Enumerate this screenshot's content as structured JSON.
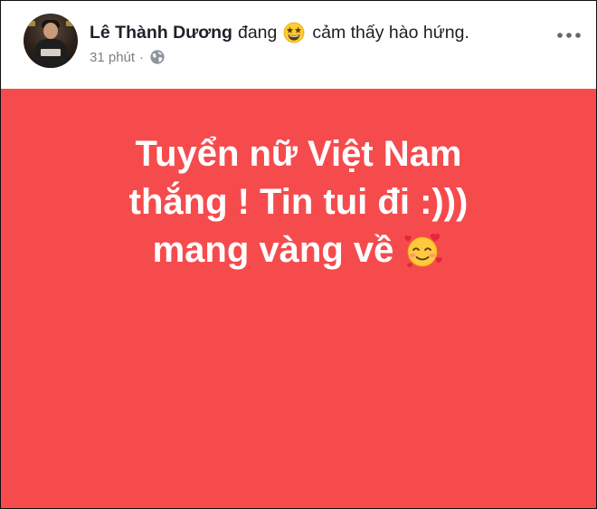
{
  "post": {
    "author_name": "Lê Thành Dương",
    "verb": "đang",
    "feeling_emoji": "star-struck-emoji",
    "feeling_text": "cảm thấy hào hứng.",
    "timestamp": "31 phút",
    "separator": "·",
    "privacy_icon": "globe-icon",
    "more_icon": "more-options-icon",
    "background_color": "#f64b4d",
    "text_lines": [
      "Tuyển nữ Việt Nam",
      "thắng ! Tin tui đi :)))",
      "mang vàng về"
    ],
    "trailing_emoji": "smiling-face-with-hearts-emoji"
  },
  "colors": {
    "author": "#1d2129",
    "meta": "#7f7f7f",
    "post_text": "#ffffff"
  }
}
